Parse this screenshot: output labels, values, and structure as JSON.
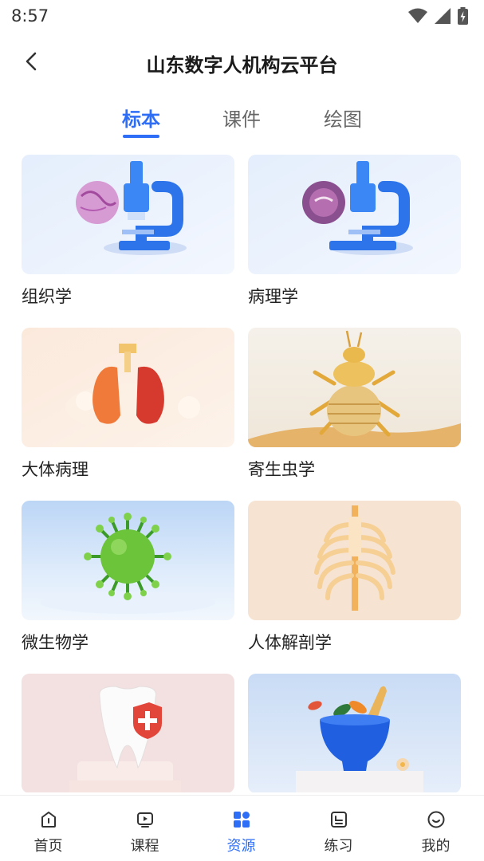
{
  "status_bar": {
    "time": "8:57",
    "icons": [
      "wifi-icon",
      "cellular-signal-icon",
      "battery-charging-icon"
    ]
  },
  "app_bar": {
    "back_icon": "chevron-left-icon",
    "title": "山东数字人机构云平台"
  },
  "tabs": [
    {
      "label": "标本",
      "active": true
    },
    {
      "label": "课件",
      "active": false
    },
    {
      "label": "绘图",
      "active": false
    }
  ],
  "cards": [
    {
      "label": "组织学",
      "image": "microscope-histology-slide"
    },
    {
      "label": "病理学",
      "image": "microscope-pathology-slide"
    },
    {
      "label": "大体病理",
      "image": "lungs-model"
    },
    {
      "label": "寄生虫学",
      "image": "bedbug-model"
    },
    {
      "label": "微生物学",
      "image": "green-virus-model"
    },
    {
      "label": "人体解剖学",
      "image": "ribcage-model"
    },
    {
      "label": "",
      "image": "tooth-with-shield"
    },
    {
      "label": "",
      "image": "herbal-mortar-bowl"
    }
  ],
  "bottom_nav": [
    {
      "label": "首页",
      "icon": "home-icon",
      "active": false
    },
    {
      "label": "课程",
      "icon": "course-play-icon",
      "active": false
    },
    {
      "label": "资源",
      "icon": "resources-grid-icon",
      "active": true
    },
    {
      "label": "练习",
      "icon": "practice-icon",
      "active": false
    },
    {
      "label": "我的",
      "icon": "profile-smile-icon",
      "active": false
    }
  ],
  "colors": {
    "accent": "#2e6df5",
    "text": "#222222",
    "muted": "#666666"
  }
}
